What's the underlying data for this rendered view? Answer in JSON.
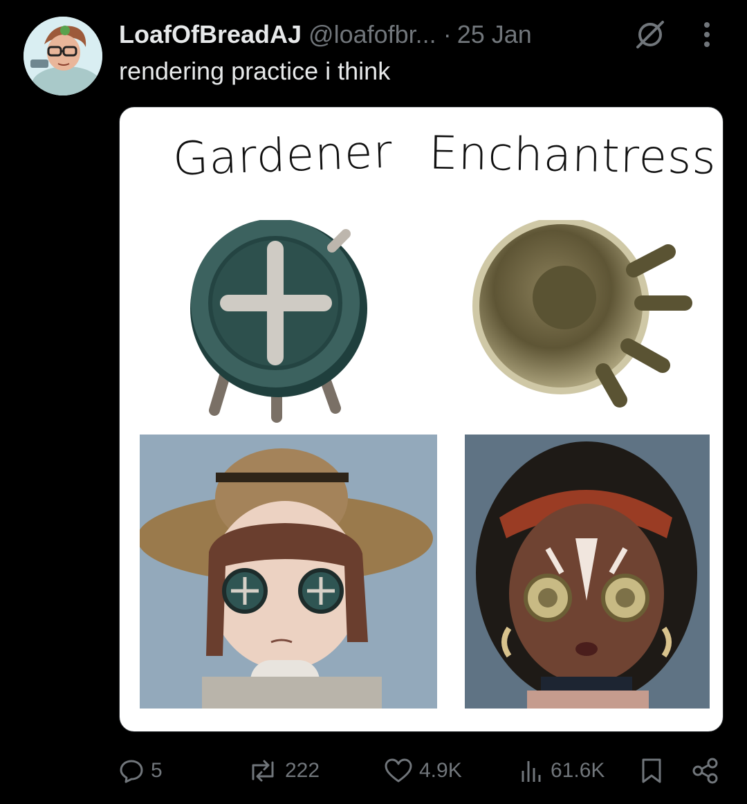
{
  "tweet": {
    "display_name": "LoafOfBreadAJ",
    "handle": "@loafofbr...",
    "separator": "·",
    "date": "25 Jan",
    "text": "rendering practice i think"
  },
  "media": {
    "left_label": "Gardener",
    "right_label": "Enchantress"
  },
  "actions": {
    "replies": "5",
    "reposts": "222",
    "likes": "4.9K",
    "views": "61.6K"
  },
  "icons": {
    "grok": "grok-icon",
    "more": "more-dots-icon",
    "reply": "reply-icon",
    "repost": "repost-icon",
    "like": "heart-icon",
    "views": "views-icon",
    "bookmark": "bookmark-icon",
    "share": "share-icon"
  },
  "colors": {
    "background": "#000000",
    "text_primary": "#e7e9ea",
    "text_secondary": "#71767b"
  }
}
